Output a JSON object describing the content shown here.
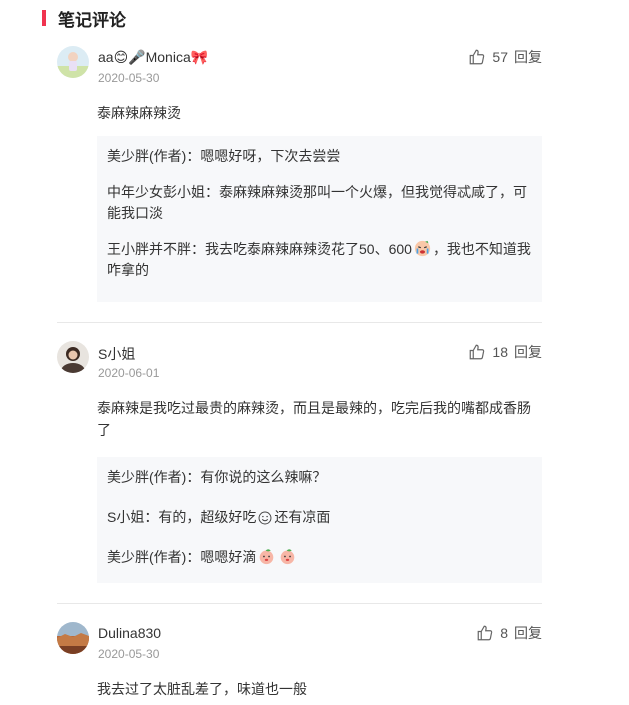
{
  "section": {
    "title": "笔记评论"
  },
  "comments": [
    {
      "user": "aa😊🎤Monica🎀",
      "date": "2020-05-30",
      "likes": "57",
      "reply_label": "回复",
      "text": "泰麻辣麻辣烫",
      "replies": [
        {
          "author": "美少胖(作者)",
          "sep": "：",
          "text": "嗯嗯好呀，下次去尝尝"
        },
        {
          "author": "中年少女彭小姐",
          "sep": "：",
          "text": "泰麻辣麻辣烫那叫一个火爆，但我觉得忒咸了，可能我口淡"
        },
        {
          "author": "王小胖并不胖",
          "sep": "：",
          "text_before": "我去吃泰麻辣麻辣烫花了50、600",
          "text_after": "，我也不知道我咋拿的"
        }
      ]
    },
    {
      "user": "S小姐",
      "date": "2020-06-01",
      "likes": "18",
      "reply_label": "回复",
      "text": "泰麻辣是我吃过最贵的麻辣烫，而且是最辣的，吃完后我的嘴都成香肠了",
      "replies": [
        {
          "author": "美少胖(作者)",
          "sep": "：",
          "text": "有你说的这么辣嘛？"
        },
        {
          "author": "S小姐",
          "sep": "：",
          "text_before": "有的，超级好吃",
          "text_after": "还有凉面"
        },
        {
          "author": "美少胖(作者)",
          "sep": "：",
          "text_before": "嗯嗯好滴",
          "text_after": ""
        }
      ]
    },
    {
      "user": "Dulina830",
      "date": "2020-05-30",
      "likes": "8",
      "reply_label": "回复",
      "text": "我去过了太脏乱差了，味道也一般"
    }
  ],
  "icons": {
    "like": "thumbs-up-icon",
    "accent": "#f0334f"
  }
}
